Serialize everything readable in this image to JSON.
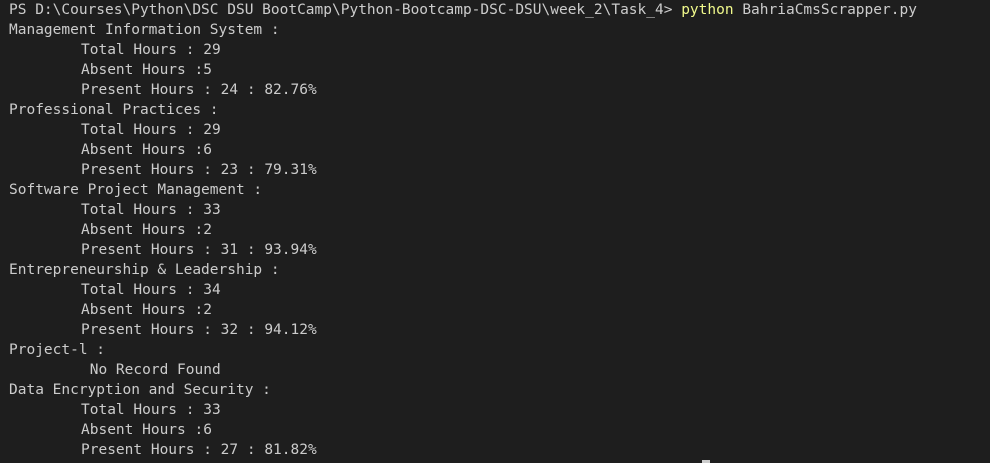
{
  "prompt": {
    "path": "PS D:\\Courses\\Python\\DSC DSU BootCamp\\Python-Bootcamp-DSC-DSU\\week_2\\Task_4> ",
    "command": "python",
    "args": " BahriaCmsScrapper.py",
    "command_color": "#f1fa8c"
  },
  "courses": [
    {
      "name": "Management Information System :",
      "lines": [
        "Total Hours : 29",
        "Absent Hours :5",
        "Present Hours : 24 : 82.76%"
      ]
    },
    {
      "name": "Professional Practices :",
      "lines": [
        "Total Hours : 29",
        "Absent Hours :6",
        "Present Hours : 23 : 79.31%"
      ]
    },
    {
      "name": "Software Project Management :",
      "lines": [
        "Total Hours : 33",
        "Absent Hours :2",
        "Present Hours : 31 : 93.94%"
      ]
    },
    {
      "name": "Entrepreneurship & Leadership :",
      "lines": [
        "Total Hours : 34",
        "Absent Hours :2",
        "Present Hours : 32 : 94.12%"
      ]
    },
    {
      "name": "Project-l :",
      "no_record": " No Record Found"
    },
    {
      "name": "Data Encryption and Security :",
      "lines": [
        "Total Hours : 33",
        "Absent Hours :6",
        "Present Hours : 27 : 81.82%"
      ]
    }
  ]
}
